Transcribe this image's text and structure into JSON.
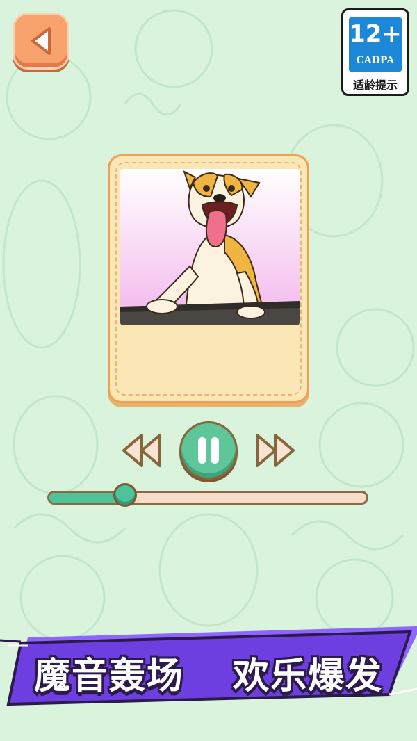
{
  "age_rating": {
    "number": "12+",
    "org": "CADPA",
    "caption": "适龄提示",
    "color": "#1e88d8"
  },
  "back_button": {
    "icon": "chevron-left-icon"
  },
  "player": {
    "image": "cartoon-dog-icon",
    "rewind_icon": "rewind-icon",
    "pause_icon": "pause-icon",
    "forward_icon": "fast-forward-icon",
    "progress": 0.24,
    "accent": "#4cc398"
  },
  "banner": {
    "part1": "魔音轰场",
    "part2": "欢乐爆发",
    "color": "#6e3fe0"
  }
}
